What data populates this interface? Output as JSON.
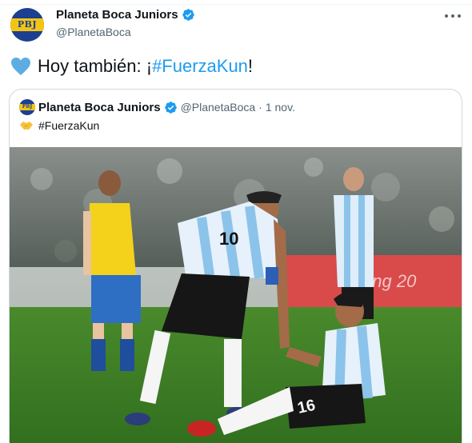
{
  "header": {
    "author_name": "Planeta Boca Juniors",
    "author_handle": "@PlanetaBoca",
    "avatar_initials": "PBJ"
  },
  "tweet": {
    "text_before": "Hoy también: ¡",
    "hashtag": "#FuerzaKun",
    "text_after": "!",
    "heart_icon": "blue-heart-icon"
  },
  "quoted": {
    "author_name": "Planeta Boca Juniors",
    "author_handle": "@PlanetaBoca",
    "separator": "·",
    "time": "1 nov.",
    "text": "#FuerzaKun",
    "hands_icon": "handshake-icon",
    "avatar_initials": "PBJ",
    "media": {
      "jersey_numbers": [
        "10",
        "16"
      ],
      "banner_text": "Beijing 20"
    }
  },
  "colors": {
    "brand_blue": "#1c3f8f",
    "brand_yellow": "#f2c515",
    "link": "#1d9bf0",
    "verified": "#1d9bf0",
    "secondary_text": "#536471",
    "border": "#cfd9de"
  }
}
